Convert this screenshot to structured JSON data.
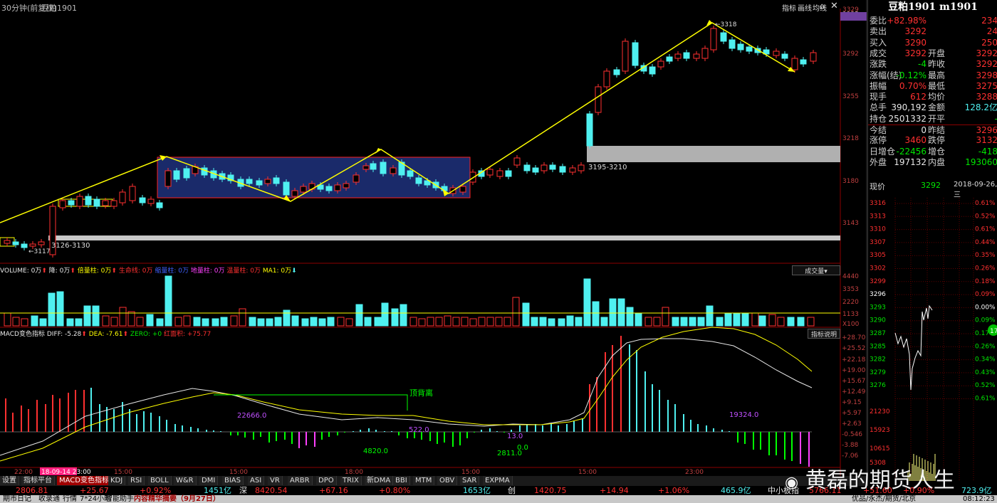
{
  "header": {
    "period_label": "30分钟(前复权)",
    "symbol": "豆粕1901",
    "tools": [
      "指标",
      "画线",
      "均线"
    ],
    "search_icon": "search-icon",
    "home_icon": "home-icon",
    "close_icon": "close-icon"
  },
  "chart": {
    "price_ticks": [
      "3329",
      "3325",
      "3292",
      "3255",
      "3218",
      "3180",
      "3143"
    ],
    "annotations": {
      "low_label": "3117",
      "high_label": "3318",
      "support_zone_label": "3126-3130",
      "resistance_zone_label": "3195-3210"
    },
    "time_labels": [
      "22:00",
      "18-09-14 23:00",
      "15:00",
      "15:00",
      "18:00",
      "15:00",
      "15:00",
      "23:00"
    ]
  },
  "volume": {
    "legend": [
      "VOLUME: 0万",
      "降: 0万",
      "倍量柱: 0万",
      "生命线: 0万",
      "缩量柱: 0万",
      "地量柱: 0万",
      "温量柱: 0万",
      "MA1: 0万"
    ],
    "select_label": "成交量",
    "ticks": [
      "4440",
      "3353",
      "2220",
      "1133",
      "X100"
    ]
  },
  "macd": {
    "title": "MACD变色指标",
    "diff": "DIFF: -5.28",
    "dea": "DEA: -7.61",
    "zero": "ZERO: +0",
    "hongmian": "红面积: +75.77",
    "explain_button": "指标说明",
    "divergence_label": "顶背离",
    "value_labels": [
      "22666.0",
      "4820.0",
      "522.0",
      "13.0",
      "2811.0",
      "0.0",
      "19324.0"
    ],
    "ticks": [
      "+28.70",
      "+25.52",
      "+22.18",
      "+19.00",
      "+15.67",
      "+12.49",
      "+9.15",
      "+5.97",
      "+2.63",
      "-0.546",
      "-3.88",
      "-7.06"
    ]
  },
  "tabs": [
    "设置",
    "指标平台",
    "MACD变色指标",
    "KDJ",
    "RSI",
    "BOLL",
    "W&R",
    "DMI",
    "BIAS",
    "ASI",
    "VR",
    "ARBR",
    "DPO",
    "TRIX",
    "新DMA",
    "BBI",
    "MTM",
    "OBV",
    "SAR",
    "EXPMA"
  ],
  "ticker": {
    "i1": "2806.81",
    "i1c": "+25.67",
    "i1p": "+0.92%",
    "i1v": "1451亿",
    "i2n": "深",
    "i2": "8420.54",
    "i2c": "+67.16",
    "i2p": "+0.80%",
    "i2v": "1653亿",
    "i3n": "创",
    "i3": "1420.75",
    "i3c": "+14.94",
    "i3p": "+1.06%",
    "i3v": "465.9亿",
    "i4n": "中小板指",
    "i4": "5766.11",
    "i4c": "+51.60",
    "i4p": "+0.90%",
    "i4v": "723.9亿"
  },
  "status": {
    "items": [
      "期市日记",
      "收录通",
      "行情",
      "7*24小时",
      "智能助手",
      "内容精华摘要（9月27日）"
    ],
    "right": [
      "优品/永杰/期货/北京",
      "08:12:23"
    ]
  },
  "quote": {
    "title": "豆粕1901 m1901",
    "rows": [
      {
        "h": "委比",
        "v": "+82.98%",
        "v2": "234"
      },
      {
        "h": "卖出",
        "v": "3292",
        "v2": "24"
      },
      {
        "h": "买入",
        "v": "3290",
        "v2": "250"
      },
      {
        "h": "成交",
        "v": "3292",
        "h2": "开盘",
        "v2": "3292"
      },
      {
        "h": "涨跌",
        "v": "-4",
        "h2": "昨收",
        "v2": "3292"
      },
      {
        "h": "涨幅(结)",
        "v": "-0.12%",
        "h2": "最高",
        "v2": "3298"
      },
      {
        "h": "振幅",
        "v": "0.70%",
        "h2": "最低",
        "v2": "3275"
      },
      {
        "h": "现手",
        "v": "612",
        "h2": "均价",
        "v2": "3288"
      },
      {
        "h": "总手",
        "v": "390,192",
        "h2": "金额",
        "v2": "128.2亿"
      },
      {
        "h": "持仓",
        "v": "2501332",
        "h2": "开平",
        "v2": "-"
      },
      {
        "h": "今结",
        "v": "0",
        "h2": "昨结",
        "v2": "3296"
      },
      {
        "h": "涨停",
        "v": "3460",
        "h2": "跌停",
        "v2": "3132"
      },
      {
        "h": "日增仓",
        "v": "-22456",
        "h2": "增仓",
        "v2": "-418"
      },
      {
        "h": "外盘",
        "v": "197132",
        "h2": "内盘",
        "v2": "193060"
      }
    ],
    "now_label": "现价",
    "now_value": "3292",
    "date": "2018-09-26,三"
  },
  "intraday": {
    "price_ticks": [
      "3316",
      "3313",
      "3310",
      "3307",
      "3305",
      "3302",
      "3299",
      "3296",
      "3293",
      "3290",
      "3287",
      "3285",
      "3282",
      "3279",
      "3276"
    ],
    "pct_ticks": [
      "0.61%",
      "0.52%",
      "0.61%",
      "0.44%",
      "0.35%",
      "0.26%",
      "0.18%",
      "0.09%",
      "0.00%",
      "0.09%",
      "0.17%",
      "0.26%",
      "0.34%",
      "0.43%",
      "0.52%",
      "0.61%"
    ],
    "vol_ticks": [
      "21230",
      "15923",
      "10615",
      "5308"
    ],
    "marker": "17"
  },
  "watermark": "黄磊的期货人生",
  "colors": {
    "up": "#ff3030",
    "down": "#4ff0f0",
    "trend": "#ffff00",
    "box": "#1a2a6a"
  }
}
